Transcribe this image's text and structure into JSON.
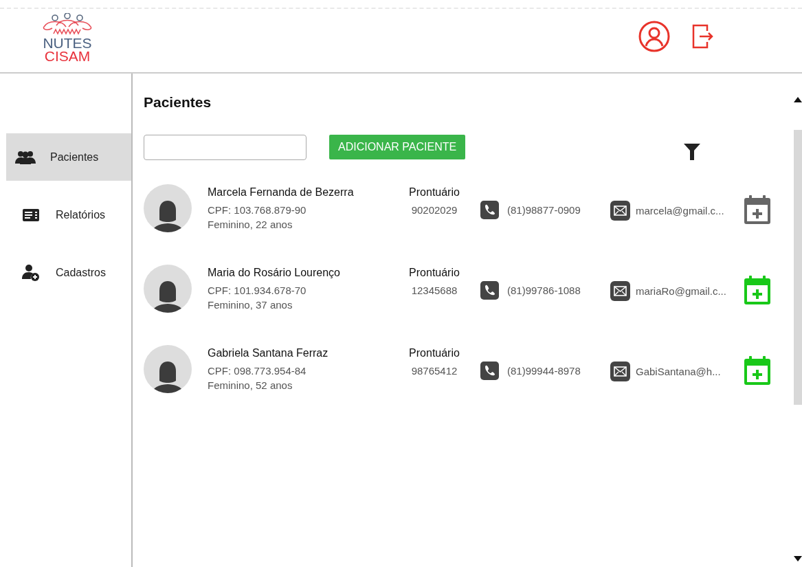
{
  "logo": {
    "line_1": "NUTES",
    "line_2": "CISAM"
  },
  "sidebar": {
    "items": [
      {
        "label": "Pacientes",
        "kind": "group",
        "selected": true
      },
      {
        "label": "Relatórios",
        "kind": "report",
        "selected": false
      },
      {
        "label": "Cadastros",
        "kind": "add-user",
        "selected": false
      }
    ]
  },
  "page": {
    "title": "Pacientes",
    "add_button": "ADICIONAR PACIENTE"
  },
  "patients": [
    {
      "name": "Marcela Fernanda de Bezerra",
      "cpf": "CPF: 103.768.879-90",
      "info": "Feminino, 22 anos",
      "record_label": "Prontuário",
      "record": "90202029",
      "phone": "(81)98877-0909",
      "email": "marcela@gmail.c...",
      "color": "#666666"
    },
    {
      "name": "Maria do Rosário Lourenço",
      "cpf": "CPF: 101.934.678-70",
      "info": "Feminino, 37 anos",
      "record_label": "Prontuário",
      "record": "12345688",
      "phone": "(81)99786-1088",
      "email": "mariaRo@gmail.c...",
      "color": "#19c819"
    },
    {
      "name": "Gabriela Santana Ferraz",
      "cpf": "CPF: 098.773.954-84",
      "info": "Feminino, 52 anos",
      "record_label": "Prontuário",
      "record": "98765412",
      "phone": "(81)99944-8978",
      "email": "GabiSantana@h...",
      "color": "#19c819"
    }
  ]
}
